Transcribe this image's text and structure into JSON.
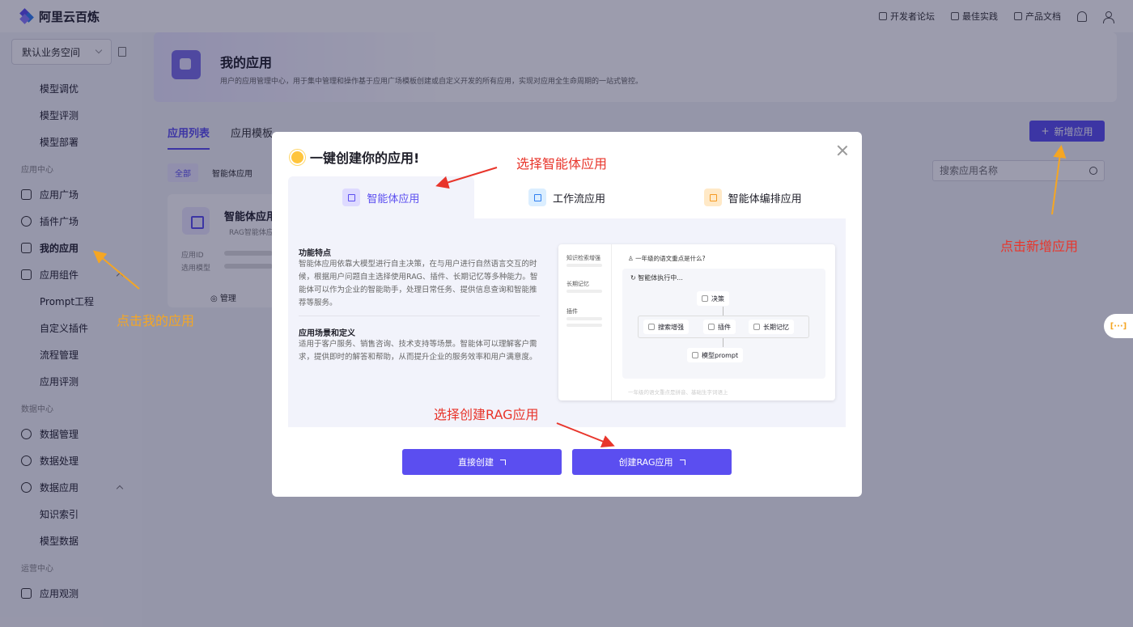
{
  "topbar": {
    "brand": "阿里云百炼",
    "links": [
      "开发者论坛",
      "最佳实践",
      "产品文档"
    ]
  },
  "sidebar": {
    "workspace": "默认业务空间",
    "items": [
      {
        "label": "模型调优",
        "kind": "sub"
      },
      {
        "label": "模型评测",
        "kind": "sub"
      },
      {
        "label": "模型部署",
        "kind": "sub"
      },
      {
        "label": "应用中心",
        "kind": "section"
      },
      {
        "label": "应用广场",
        "kind": "top"
      },
      {
        "label": "插件广场",
        "kind": "top"
      },
      {
        "label": "我的应用",
        "kind": "top"
      },
      {
        "label": "应用组件",
        "kind": "top"
      },
      {
        "label": "Prompt工程",
        "kind": "sub"
      },
      {
        "label": "自定义插件",
        "kind": "sub"
      },
      {
        "label": "流程管理",
        "kind": "sub"
      },
      {
        "label": "应用评测",
        "kind": "sub"
      },
      {
        "label": "数据中心",
        "kind": "section"
      },
      {
        "label": "数据管理",
        "kind": "top"
      },
      {
        "label": "数据处理",
        "kind": "top"
      },
      {
        "label": "数据应用",
        "kind": "top"
      },
      {
        "label": "知识索引",
        "kind": "sub"
      },
      {
        "label": "模型数据",
        "kind": "sub"
      },
      {
        "label": "运营中心",
        "kind": "section"
      },
      {
        "label": "应用观测",
        "kind": "top"
      }
    ]
  },
  "main": {
    "title": "我的应用",
    "description": "用户的应用管理中心，用于集中管理和操作基于应用广场模板创建或自定义开发的所有应用，实现对应用全生命周期的一站式管控。",
    "tabs": [
      "应用列表",
      "应用模板"
    ],
    "add_button": "新增应用",
    "filters": [
      "全部",
      "智能体应用"
    ],
    "search_placeholder": "搜索应用名称",
    "card": {
      "name": "智能体应用",
      "subtitle": "RAG智能体应",
      "meta_id": "应用ID",
      "meta_model": "选用模型",
      "manage": "管理"
    }
  },
  "modal": {
    "title": "一键创建你的应用!",
    "tabs": [
      "智能体应用",
      "工作流应用",
      "智能体编排应用"
    ],
    "features_title": "功能特点",
    "features_text": "智能体应用依靠大模型进行自主决策，在与用户进行自然语言交互的时候，根据用户问题自主选择使用RAG、插件、长期记忆等多种能力。智能体可以作为企业的智能助手，处理日常任务、提供信息查询和智能推荐等服务。",
    "scenes_title": "应用场景和定义",
    "scenes_text": "适用于客户服务、销售咨询、技术支持等场景。智能体可以理解客户需求，提供即时的解答和帮助，从而提升企业的服务效率和用户满意度。",
    "preview": {
      "side": [
        "知识检索增强",
        "长期记忆",
        "插件"
      ],
      "question": "一年级的语文重点是什么?",
      "running": "智能体执行中...",
      "decision": "决策",
      "nodes": [
        "搜索增强",
        "插件",
        "长期记忆"
      ],
      "model": "模型prompt",
      "footer": "一年级的语文重点是拼音、基础生字词语上"
    },
    "btn_direct": "直接创建",
    "btn_rag": "创建RAG应用"
  },
  "annotations": {
    "select_agent": "选择智能体应用",
    "click_add": "点击新增应用",
    "click_my_app": "点击我的应用",
    "select_rag": "选择创建RAG应用"
  },
  "float_button": "[···]",
  "colors": {
    "accent": "#5b4ef0",
    "annotation_red": "#e8352b",
    "annotation_yellow": "#f5a623"
  }
}
